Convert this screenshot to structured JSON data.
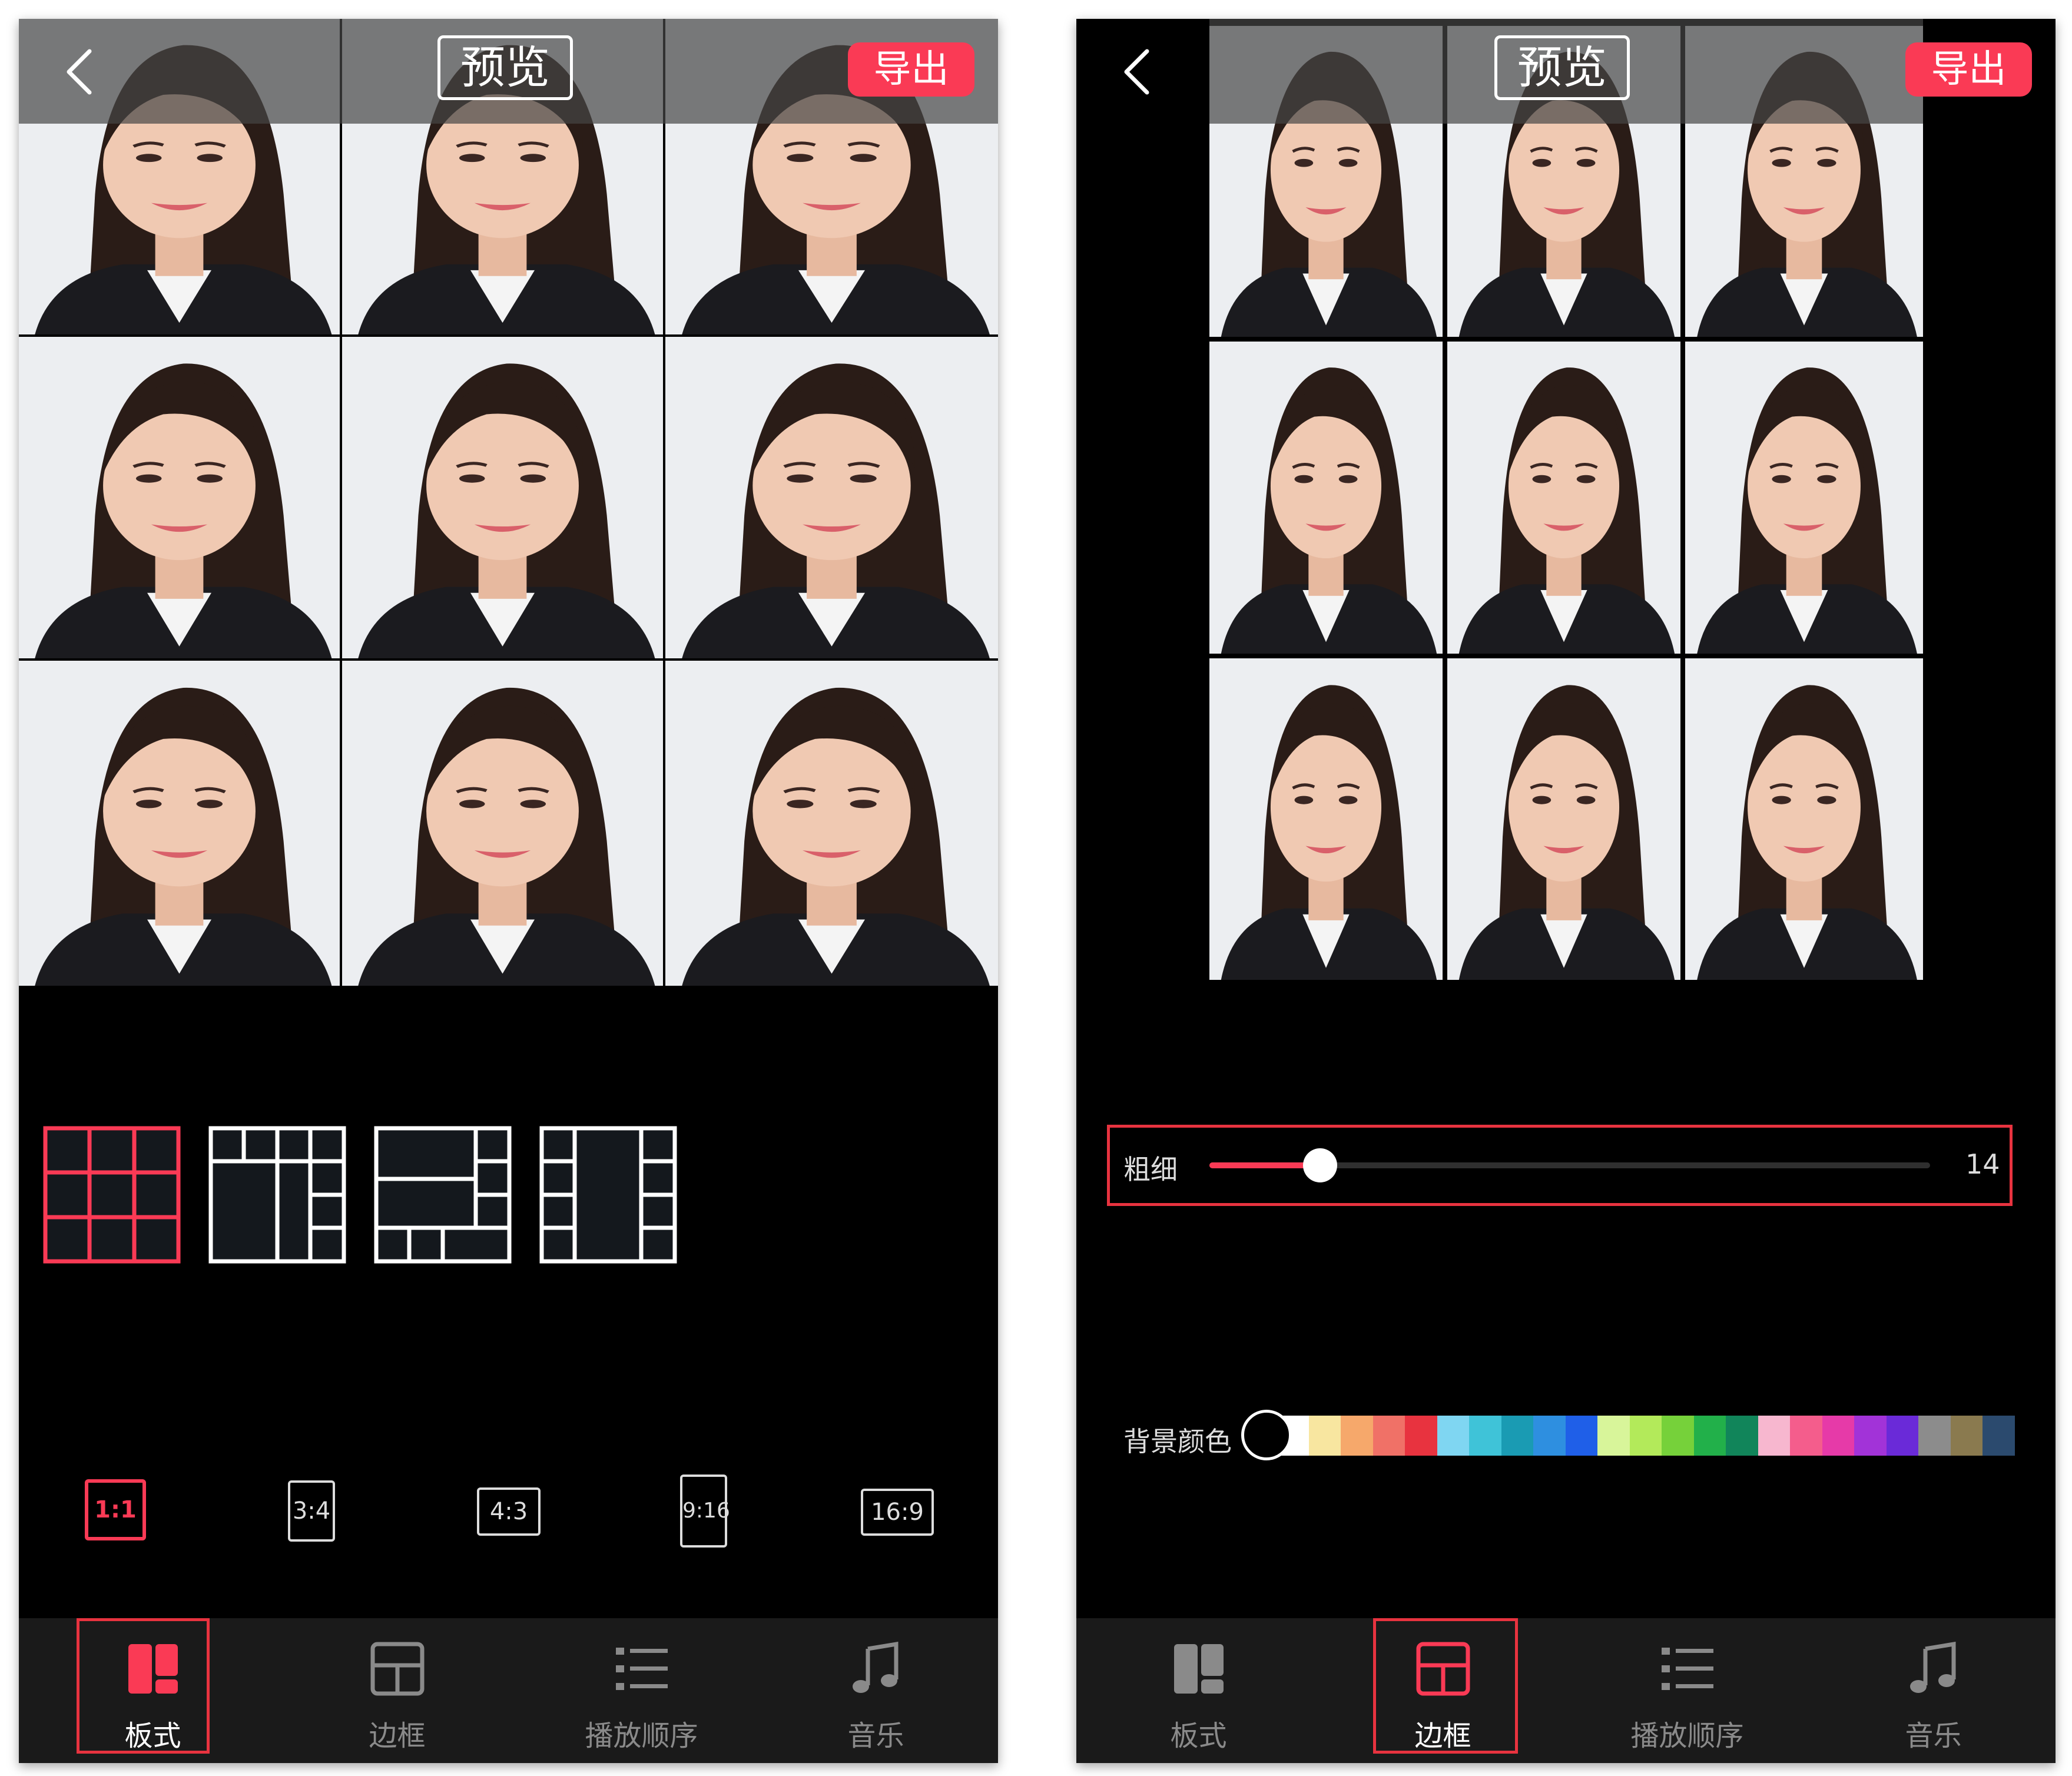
{
  "left_screen": {
    "title": "预览",
    "export_label": "导出",
    "ratios": [
      "1:1",
      "3:4",
      "4:3",
      "9:16",
      "16:9"
    ],
    "selected_ratio": "1:1",
    "layout_options": [
      "grid-3x3",
      "layout-b",
      "layout-c",
      "layout-d"
    ],
    "selected_layout": "grid-3x3"
  },
  "right_screen": {
    "title": "预览",
    "export_label": "导出",
    "thickness_label": "粗细",
    "thickness_value": "14",
    "background_color_label": "背景颜色",
    "palette": [
      "#ffffff",
      "#f8e6a0",
      "#f6a86b",
      "#f07167",
      "#e8333f",
      "#7fd6f2",
      "#3fc3d8",
      "#1a9bb3",
      "#2e8fe0",
      "#1f5fe8",
      "#d8f59a",
      "#b3ea5a",
      "#76d13a",
      "#22b04a",
      "#11855a",
      "#f7b7cf",
      "#f45d8c",
      "#e63aa8",
      "#a233d8",
      "#6a2ad8",
      "#8c8c8c",
      "#8a7a4f",
      "#2b4a6e"
    ],
    "selected_color": "#000000"
  },
  "nav": {
    "items": [
      "板式",
      "边框",
      "播放顺序",
      "音乐"
    ]
  },
  "colors": {
    "accent": "#fa3a55",
    "highlight": "#e8333f",
    "background": "#000000",
    "navbar": "#1a1a1a"
  },
  "icons": [
    "back-chevron-icon",
    "layout-icon",
    "border-icon",
    "list-icon",
    "music-note-icon"
  ]
}
